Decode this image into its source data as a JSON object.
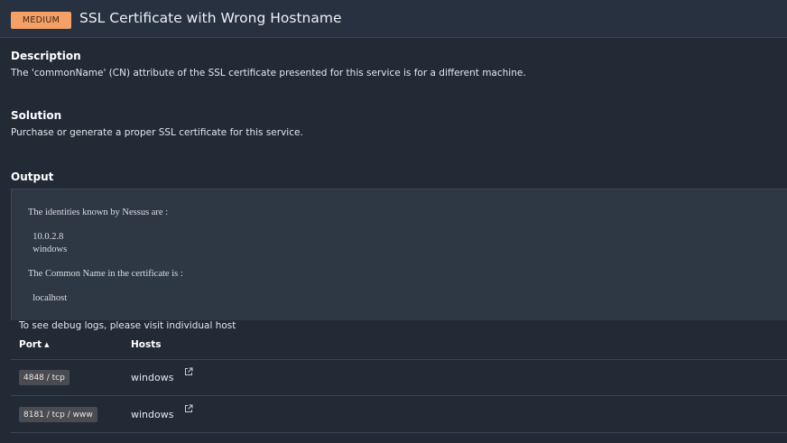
{
  "header": {
    "severity": "MEDIUM",
    "title": "SSL Certificate with Wrong Hostname"
  },
  "description": {
    "heading": "Description",
    "text": "The 'commonName' (CN) attribute of the SSL certificate presented for this service is for a different machine."
  },
  "solution": {
    "heading": "Solution",
    "text": "Purchase or generate a proper SSL certificate for this service."
  },
  "output": {
    "heading": "Output",
    "text": "The identities known by Nessus are :\n\n  10.0.2.8\n  windows\n\nThe Common Name in the certificate is :\n\n  localhost",
    "debug_note": "To see debug logs, please visit individual host"
  },
  "table": {
    "col_port": "Port",
    "col_port_sort": "▲",
    "col_hosts": "Hosts",
    "rows": [
      {
        "port": "4848 / tcp",
        "host": "windows"
      },
      {
        "port": "8181 / tcp / www",
        "host": "windows"
      }
    ]
  },
  "colors": {
    "severity_badge": "#f5a166",
    "background": "#222a36"
  },
  "icons": {
    "row_link": "external-link-icon"
  }
}
